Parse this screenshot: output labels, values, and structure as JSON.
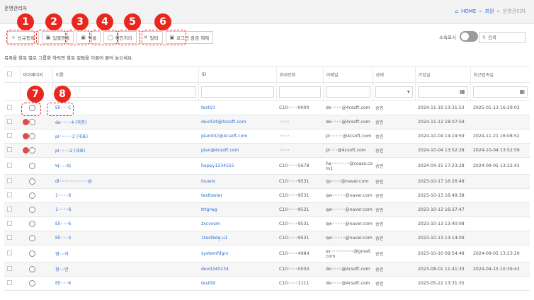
{
  "header": {
    "title": "운영관리자",
    "breadcrumb": {
      "home": "HOME",
      "sep": "»",
      "level1": "회원",
      "level2": "운영관리자"
    }
  },
  "toolbar": {
    "buttons": [
      {
        "icon": "+",
        "label": "신규등록"
      },
      {
        "icon": "▣",
        "label": "일괄등록"
      },
      {
        "icon": "▣",
        "label": "엑셀"
      },
      {
        "icon": "◯",
        "label": "확인처리"
      },
      {
        "icon": "✕",
        "label": "탈퇴"
      },
      {
        "icon": "▣",
        "label": "로그인 잠금 해제"
      }
    ]
  },
  "annotations": {
    "badges": [
      "1",
      "2",
      "3",
      "4",
      "5",
      "6",
      "7",
      "8"
    ]
  },
  "filters": {
    "group_toggle_label": "소속표시",
    "search_placeholder": "검색"
  },
  "notice": "목록을 항목 별로 그룹화 하려면 항목 컬럼을 이끌어 끌어 놓으세요.",
  "table": {
    "headers": [
      "",
      "마이페이지",
      "이름",
      "ID",
      "휴대전화",
      "이메일",
      "상태",
      "가입일",
      "최근접속일"
    ],
    "rows": [
      {
        "red": false,
        "name": "Ell◦◦◦C",
        "id": "test10",
        "phone": "C10◦◦◦◦0000",
        "email": "de◦◦◦◦@4csoft.com",
        "status": "승인",
        "joined": "2024-11-19 13:31:53",
        "last": "2025-01-13 16:29:03"
      },
      {
        "red": true,
        "name": "de◦◦◦◦4 (과장)",
        "id": "dev024@4csoft.com",
        "phone": "◦◦◦◦",
        "email": "de◦◦◦◦@4csoft.com",
        "status": "승인",
        "joined": "2024-11-12 18:07:59",
        "last": ""
      },
      {
        "red": true,
        "name": "pl◦◦◦◦◦2 (대표)",
        "id": "plan002@4csoft.com",
        "phone": "◦◦◦◦",
        "email": "pl◦◦◦◦◦@4csoft.com",
        "status": "승인",
        "joined": "2024-10-04 14:19:59",
        "last": "2024-11-21 16:08:52"
      },
      {
        "red": true,
        "name": "pl◦◦◦◦2 (대표)",
        "id": "plan@4csoft.com",
        "phone": "◦◦◦◦",
        "email": "pl◦◦◦@4csoft.com",
        "status": "승인",
        "joined": "2024-10-04 13:52:28",
        "last": "2024-10-04 13:52:59"
      },
      {
        "red": false,
        "name": "박◦◦◦타",
        "id": "happy1234555",
        "phone": "C10◦◦◦◦5678",
        "email": "ha◦◦◦◦◦◦◦@coass.co m1",
        "status": "승인",
        "joined": "2024-04-15 17:23:28",
        "last": "2024-09-05 13:22:43"
      },
      {
        "red": false,
        "name": "dl◦◦◦◦◦◦◦◦◦◦◦@",
        "id": "iouwio",
        "phone": "C10◦◦◦◦9531",
        "email": "qs◦◦◦◦@naver.com",
        "status": "승인",
        "joined": "2023-10-17 16:26:49",
        "last": ""
      },
      {
        "red": false,
        "name": "1◦◦◦◦6",
        "id": "testtester",
        "phone": "C10◦◦◦◦9531",
        "email": "qw◦◦◦◦◦@naver.com",
        "status": "승인",
        "joined": "2023-10-13 16:49:38",
        "last": ""
      },
      {
        "red": false,
        "name": "1◦◦◦◦6",
        "id": "trtgrwg",
        "phone": "C10◦◦◦◦9531",
        "email": "qw◦◦◦◦◦@naver.com",
        "status": "승인",
        "joined": "2023-10-13 16:37:47",
        "last": ""
      },
      {
        "red": false,
        "name": "Ell◦◦◦6",
        "id": "zxcvosm",
        "phone": "C10◦◦◦◦9531",
        "email": "qw◦◦◦◦◦@naver.com",
        "status": "승인",
        "joined": "2023-10-13 13:40:08",
        "last": ""
      },
      {
        "red": false,
        "name": "Ell◦◦◦3",
        "id": "1test6dg.u1",
        "phone": "C10◦◦◦◦9531",
        "email": "qw◦◦◦◦◦@naver.com",
        "status": "승인",
        "joined": "2023-10-13 13:14:09",
        "last": ""
      },
      {
        "red": false,
        "name": "영◦◦자",
        "id": "systemfdgrx",
        "phone": "C10◦◦◦◦4984",
        "email": "ss◦◦◦◦◦◦◦◦◦@gmail. com",
        "status": "승인",
        "joined": "2023-10-10 09:54:48",
        "last": "2024-09-05 13:23:20"
      },
      {
        "red": false,
        "name": "정◦◦언",
        "id": "dev0240234",
        "phone": "C10◦◦◦◦0000",
        "email": "de◦◦◦◦@4csoft.com",
        "status": "승인",
        "joined": "2023-08-01 11:41:33",
        "last": "2024-04-15 10:39:43"
      },
      {
        "red": false,
        "name": "Ell◦◦◦6",
        "id": "test09",
        "phone": "C10◦◦◦◦1111",
        "email": "de◦◦◦◦@4csoft.com",
        "status": "승인",
        "joined": "2023-05-22 13:31:35",
        "last": ""
      }
    ]
  },
  "colors": {
    "accent": "#2f6ecb",
    "annotation": "#e8281e",
    "mypage_active": "#e24a4a"
  }
}
